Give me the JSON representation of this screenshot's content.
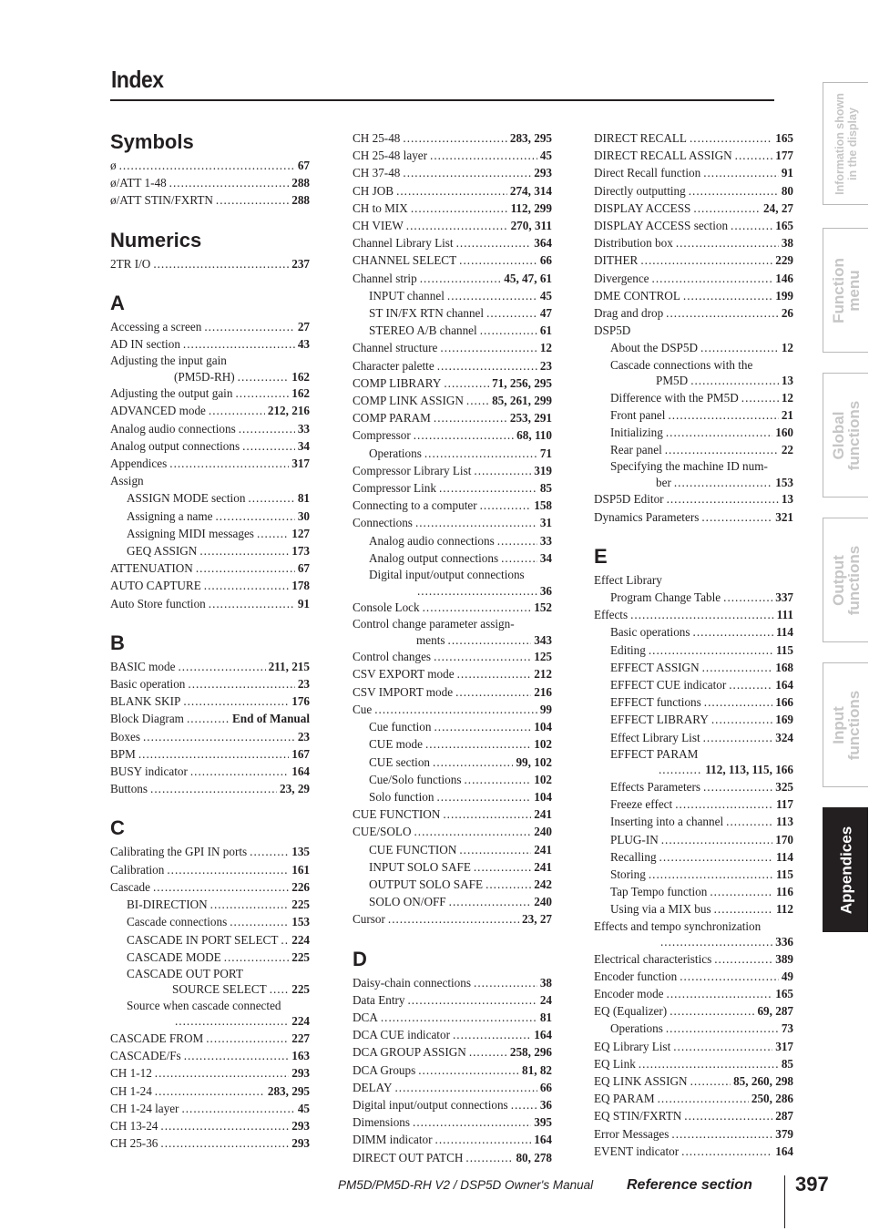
{
  "page": {
    "title": "Index",
    "footer": {
      "manual": "PM5D/PM5D-RH V2 / DSP5D Owner's Manual",
      "section": "Reference section",
      "page_number": "397"
    },
    "side_tabs": [
      {
        "label": "Information shown\nin the display",
        "active": false
      },
      {
        "label": "Function\nmenu",
        "active": false
      },
      {
        "label": "Global\nfunctions",
        "active": false
      },
      {
        "label": "Output\nfunctions",
        "active": false
      },
      {
        "label": "Input\nfunctions",
        "active": false
      },
      {
        "label": "Appendices",
        "active": true
      }
    ]
  },
  "columns": [
    [
      {
        "heading": "Symbols",
        "entries": [
          {
            "label": "ø",
            "pages": "67"
          },
          {
            "label": "ø/ATT 1-48",
            "pages": "288"
          },
          {
            "label": "ø/ATT STIN/FXRTN",
            "pages": "288"
          }
        ]
      },
      {
        "heading": "Numerics",
        "entries": [
          {
            "label": "2TR I/O",
            "pages": "237"
          }
        ]
      },
      {
        "heading": "A",
        "entries": [
          {
            "label": "Accessing a screen",
            "pages": "27"
          },
          {
            "label": "AD IN section",
            "pages": "43"
          },
          {
            "label": "Adjusting the input gain",
            "cont": "(PM5D-RH)",
            "pages": "162"
          },
          {
            "label": "Adjusting the output gain",
            "pages": "162"
          },
          {
            "label": "ADVANCED mode",
            "pages": "212, 216"
          },
          {
            "label": "Analog audio connections",
            "pages": "33"
          },
          {
            "label": "Analog output connections",
            "pages": "34"
          },
          {
            "label": "Appendices",
            "pages": "317"
          },
          {
            "label": "Assign",
            "pages": ""
          },
          {
            "label": "ASSIGN MODE section",
            "pages": "81",
            "sub": true
          },
          {
            "label": "Assigning a name",
            "pages": "30",
            "sub": true
          },
          {
            "label": "Assigning MIDI messages",
            "pages": "127",
            "sub": true
          },
          {
            "label": "GEQ ASSIGN",
            "pages": "173",
            "sub": true
          },
          {
            "label": "ATTENUATION",
            "pages": "67"
          },
          {
            "label": "AUTO CAPTURE",
            "pages": "178"
          },
          {
            "label": "Auto Store function",
            "pages": "91"
          }
        ]
      },
      {
        "heading": "B",
        "entries": [
          {
            "label": "BASIC mode",
            "pages": "211, 215"
          },
          {
            "label": "Basic operation",
            "pages": "23"
          },
          {
            "label": "BLANK SKIP",
            "pages": "176"
          },
          {
            "label": "Block Diagram",
            "pages": "End of Manual"
          },
          {
            "label": "Boxes",
            "pages": "23"
          },
          {
            "label": "BPM",
            "pages": "167"
          },
          {
            "label": "BUSY indicator",
            "pages": "164"
          },
          {
            "label": "Buttons",
            "pages": "23, 29"
          }
        ]
      },
      {
        "heading": "C",
        "entries": [
          {
            "label": "Calibrating the GPI IN ports",
            "pages": "135"
          },
          {
            "label": "Calibration",
            "pages": "161"
          },
          {
            "label": "Cascade",
            "pages": "226"
          },
          {
            "label": "BI-DIRECTION",
            "pages": "225",
            "sub": true
          },
          {
            "label": "Cascade connections",
            "pages": "153",
            "sub": true
          },
          {
            "label": "CASCADE IN PORT SELECT",
            "pages": "224",
            "sub": true
          },
          {
            "label": "CASCADE MODE",
            "pages": "225",
            "sub": true
          },
          {
            "label": "CASCADE OUT PORT",
            "cont": "SOURCE SELECT",
            "pages": "225",
            "sub": true
          },
          {
            "label": "Source when cascade connected",
            "cont": "",
            "pages": "224",
            "sub": true
          },
          {
            "label": "CASCADE FROM",
            "pages": "227"
          },
          {
            "label": "CASCADE/Fs",
            "pages": "163"
          },
          {
            "label": "CH 1-12",
            "pages": "293"
          },
          {
            "label": "CH 1-24",
            "pages": "283, 295"
          },
          {
            "label": "CH 1-24 layer",
            "pages": "45"
          },
          {
            "label": "CH 13-24",
            "pages": "293"
          },
          {
            "label": "CH 25-36",
            "pages": "293"
          }
        ]
      }
    ],
    [
      {
        "heading": "",
        "entries": [
          {
            "label": "CH 25-48",
            "pages": "283, 295"
          },
          {
            "label": "CH 25-48 layer",
            "pages": "45"
          },
          {
            "label": "CH 37-48",
            "pages": "293"
          },
          {
            "label": "CH JOB",
            "pages": "274, 314"
          },
          {
            "label": "CH to MIX",
            "pages": "112, 299"
          },
          {
            "label": "CH VIEW",
            "pages": "270, 311"
          },
          {
            "label": "Channel Library List",
            "pages": "364"
          },
          {
            "label": "CHANNEL SELECT",
            "pages": "66"
          },
          {
            "label": "Channel strip",
            "pages": "45, 47, 61"
          },
          {
            "label": "INPUT channel",
            "pages": "45",
            "sub": true
          },
          {
            "label": "ST IN/FX RTN channel",
            "pages": "47",
            "sub": true
          },
          {
            "label": "STEREO A/B channel",
            "pages": "61",
            "sub": true
          },
          {
            "label": "Channel structure",
            "pages": "12"
          },
          {
            "label": "Character palette",
            "pages": "23"
          },
          {
            "label": "COMP LIBRARY",
            "pages": "71, 256, 295"
          },
          {
            "label": "COMP LINK ASSIGN",
            "pages": "85, 261, 299"
          },
          {
            "label": "COMP PARAM",
            "pages": "253, 291"
          },
          {
            "label": "Compressor",
            "pages": "68, 110"
          },
          {
            "label": "Operations",
            "pages": "71",
            "sub": true
          },
          {
            "label": "Compressor Library List",
            "pages": "319"
          },
          {
            "label": "Compressor Link",
            "pages": "85"
          },
          {
            "label": "Connecting to a computer",
            "pages": "158"
          },
          {
            "label": "Connections",
            "pages": "31"
          },
          {
            "label": "Analog audio connections",
            "pages": "33",
            "sub": true
          },
          {
            "label": "Analog output connections",
            "pages": "34",
            "sub": true
          },
          {
            "label": "Digital input/output connections",
            "cont": "",
            "pages": "36",
            "sub": true
          },
          {
            "label": "Console Lock",
            "pages": "152"
          },
          {
            "label": "Control change parameter assign-",
            "cont": "ments",
            "pages": "343"
          },
          {
            "label": "Control changes",
            "pages": "125"
          },
          {
            "label": "CSV EXPORT mode",
            "pages": "212"
          },
          {
            "label": "CSV IMPORT mode",
            "pages": "216"
          },
          {
            "label": "Cue",
            "pages": "99"
          },
          {
            "label": "Cue function",
            "pages": "104",
            "sub": true
          },
          {
            "label": "CUE mode",
            "pages": "102",
            "sub": true
          },
          {
            "label": "CUE section",
            "pages": "99, 102",
            "sub": true
          },
          {
            "label": "Cue/Solo functions",
            "pages": "102",
            "sub": true
          },
          {
            "label": "Solo function",
            "pages": "104",
            "sub": true
          },
          {
            "label": "CUE FUNCTION",
            "pages": "241"
          },
          {
            "label": "CUE/SOLO",
            "pages": "240"
          },
          {
            "label": "CUE FUNCTION",
            "pages": "241",
            "sub": true
          },
          {
            "label": "INPUT SOLO SAFE",
            "pages": "241",
            "sub": true
          },
          {
            "label": "OUTPUT SOLO SAFE",
            "pages": "242",
            "sub": true
          },
          {
            "label": "SOLO ON/OFF",
            "pages": "240",
            "sub": true
          },
          {
            "label": "Cursor",
            "pages": "23, 27"
          }
        ]
      },
      {
        "heading": "D",
        "entries": [
          {
            "label": "Daisy-chain connections",
            "pages": "38"
          },
          {
            "label": "Data Entry",
            "pages": "24"
          },
          {
            "label": "DCA",
            "pages": "81"
          },
          {
            "label": "DCA CUE indicator",
            "pages": "164"
          },
          {
            "label": "DCA GROUP ASSIGN",
            "pages": "258, 296"
          },
          {
            "label": "DCA Groups",
            "pages": "81, 82"
          },
          {
            "label": "DELAY",
            "pages": "66"
          },
          {
            "label": "Digital input/output connections",
            "pages": "36"
          },
          {
            "label": "Dimensions",
            "pages": "395"
          },
          {
            "label": "DIMM indicator",
            "pages": "164"
          },
          {
            "label": "DIRECT OUT PATCH",
            "pages": "80, 278"
          }
        ]
      }
    ],
    [
      {
        "heading": "",
        "entries": [
          {
            "label": "DIRECT RECALL",
            "pages": "165"
          },
          {
            "label": "DIRECT RECALL ASSIGN",
            "pages": "177"
          },
          {
            "label": "Direct Recall function",
            "pages": "91"
          },
          {
            "label": "Directly outputting",
            "pages": "80"
          },
          {
            "label": "DISPLAY ACCESS",
            "pages": "24, 27"
          },
          {
            "label": "DISPLAY ACCESS section",
            "pages": "165"
          },
          {
            "label": "Distribution box",
            "pages": "38"
          },
          {
            "label": "DITHER",
            "pages": "229"
          },
          {
            "label": "Divergence",
            "pages": "146"
          },
          {
            "label": "DME CONTROL",
            "pages": "199"
          },
          {
            "label": "Drag and drop",
            "pages": "26"
          },
          {
            "label": "DSP5D",
            "pages": ""
          },
          {
            "label": "About the DSP5D",
            "pages": "12",
            "sub": true
          },
          {
            "label": "Cascade connections with the",
            "cont": "PM5D",
            "pages": "13",
            "sub": true
          },
          {
            "label": "Difference with the PM5D",
            "pages": "12",
            "sub": true
          },
          {
            "label": "Front panel",
            "pages": "21",
            "sub": true
          },
          {
            "label": "Initializing",
            "pages": "160",
            "sub": true
          },
          {
            "label": "Rear panel",
            "pages": "22",
            "sub": true
          },
          {
            "label": "Specifying the machine ID num-",
            "cont": "ber",
            "pages": "153",
            "sub": true
          },
          {
            "label": "DSP5D Editor",
            "pages": "13"
          },
          {
            "label": "Dynamics Parameters",
            "pages": "321"
          }
        ]
      },
      {
        "heading": "E",
        "entries": [
          {
            "label": "Effect Library",
            "pages": ""
          },
          {
            "label": "Program Change Table",
            "pages": "337",
            "sub": true
          },
          {
            "label": "Effects",
            "pages": "111"
          },
          {
            "label": "Basic operations",
            "pages": "114",
            "sub": true
          },
          {
            "label": "Editing",
            "pages": "115",
            "sub": true
          },
          {
            "label": "EFFECT ASSIGN",
            "pages": "168",
            "sub": true
          },
          {
            "label": "EFFECT CUE indicator",
            "pages": "164",
            "sub": true
          },
          {
            "label": "EFFECT functions",
            "pages": "166",
            "sub": true
          },
          {
            "label": "EFFECT LIBRARY",
            "pages": "169",
            "sub": true
          },
          {
            "label": "Effect Library List",
            "pages": "324",
            "sub": true
          },
          {
            "label": "EFFECT PARAM",
            "cont": "",
            "pages": "112, 113, 115, 166",
            "sub": true
          },
          {
            "label": "Effects Parameters",
            "pages": "325",
            "sub": true
          },
          {
            "label": "Freeze effect",
            "pages": "117",
            "sub": true
          },
          {
            "label": "Inserting into a channel",
            "pages": "113",
            "sub": true
          },
          {
            "label": "PLUG-IN",
            "pages": "170",
            "sub": true
          },
          {
            "label": "Recalling",
            "pages": "114",
            "sub": true
          },
          {
            "label": "Storing",
            "pages": "115",
            "sub": true
          },
          {
            "label": "Tap Tempo function",
            "pages": "116",
            "sub": true
          },
          {
            "label": "Using via a MIX bus",
            "pages": "112",
            "sub": true
          },
          {
            "label": "Effects and tempo synchronization",
            "cont": "",
            "pages": "336"
          },
          {
            "label": "Electrical characteristics",
            "pages": "389"
          },
          {
            "label": "Encoder function",
            "pages": "49"
          },
          {
            "label": "Encoder mode",
            "pages": "165"
          },
          {
            "label": "EQ (Equalizer)",
            "pages": "69, 287"
          },
          {
            "label": "Operations",
            "pages": "73",
            "sub": true
          },
          {
            "label": "EQ Library List",
            "pages": "317"
          },
          {
            "label": "EQ Link",
            "pages": "85"
          },
          {
            "label": "EQ LINK ASSIGN",
            "pages": "85, 260, 298"
          },
          {
            "label": "EQ PARAM",
            "pages": "250, 286"
          },
          {
            "label": "EQ STIN/FXRTN",
            "pages": "287"
          },
          {
            "label": "Error Messages",
            "pages": "379"
          },
          {
            "label": "EVENT indicator",
            "pages": "164"
          }
        ]
      }
    ]
  ]
}
